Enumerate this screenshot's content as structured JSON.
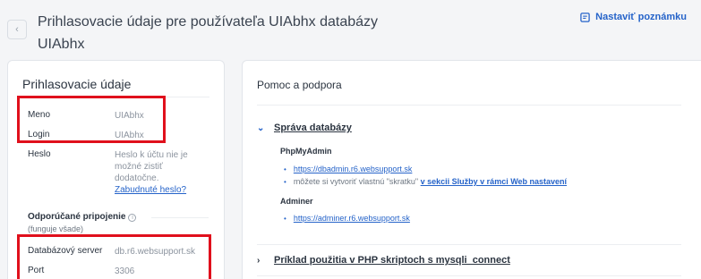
{
  "header": {
    "title": "Prihlasovacie údaje pre používateľa UIAbhx databázy UIAbhx",
    "notes_button": "Nastaviť poznámku"
  },
  "credentials": {
    "title": "Prihlasovacie údaje",
    "name_label": "Meno",
    "name_value": "UIAbhx",
    "login_label": "Login",
    "login_value": "UIAbhx",
    "password_label": "Heslo",
    "password_note": "Heslo k účtu nie je možné zistiť dodatočne.",
    "forgot_link": "Zabudnuté heslo?",
    "recommended_title": "Odporúčané pripojenie",
    "recommended_note": "(funguje všade)",
    "server_label": "Databázový server",
    "server_value": "db.r6.websupport.sk",
    "port_label": "Port",
    "port_value": "3306"
  },
  "help": {
    "title": "Pomoc a podpora",
    "section1_title": "Správa databázy",
    "phpmyadmin_title": "PhpMyAdmin",
    "phpmyadmin_link": "https://dbadmin.r6.websupport.sk",
    "shortcut_text": "môžete si vytvoriť vlastnú \"skratku\"",
    "shortcut_link": "v sekcii Služby v rámci Web nastavení",
    "adminer_title": "Adminer",
    "adminer_link": "https://adminer.r6.websupport.sk",
    "section2_title": "Príklad použitia v PHP skriptoch s mysqli_connect"
  },
  "colors": {
    "accent": "#2563c9",
    "highlight": "#e0101c"
  },
  "icons": {
    "back": "chevron-left-icon",
    "notes": "note-icon",
    "info": "info-icon"
  }
}
